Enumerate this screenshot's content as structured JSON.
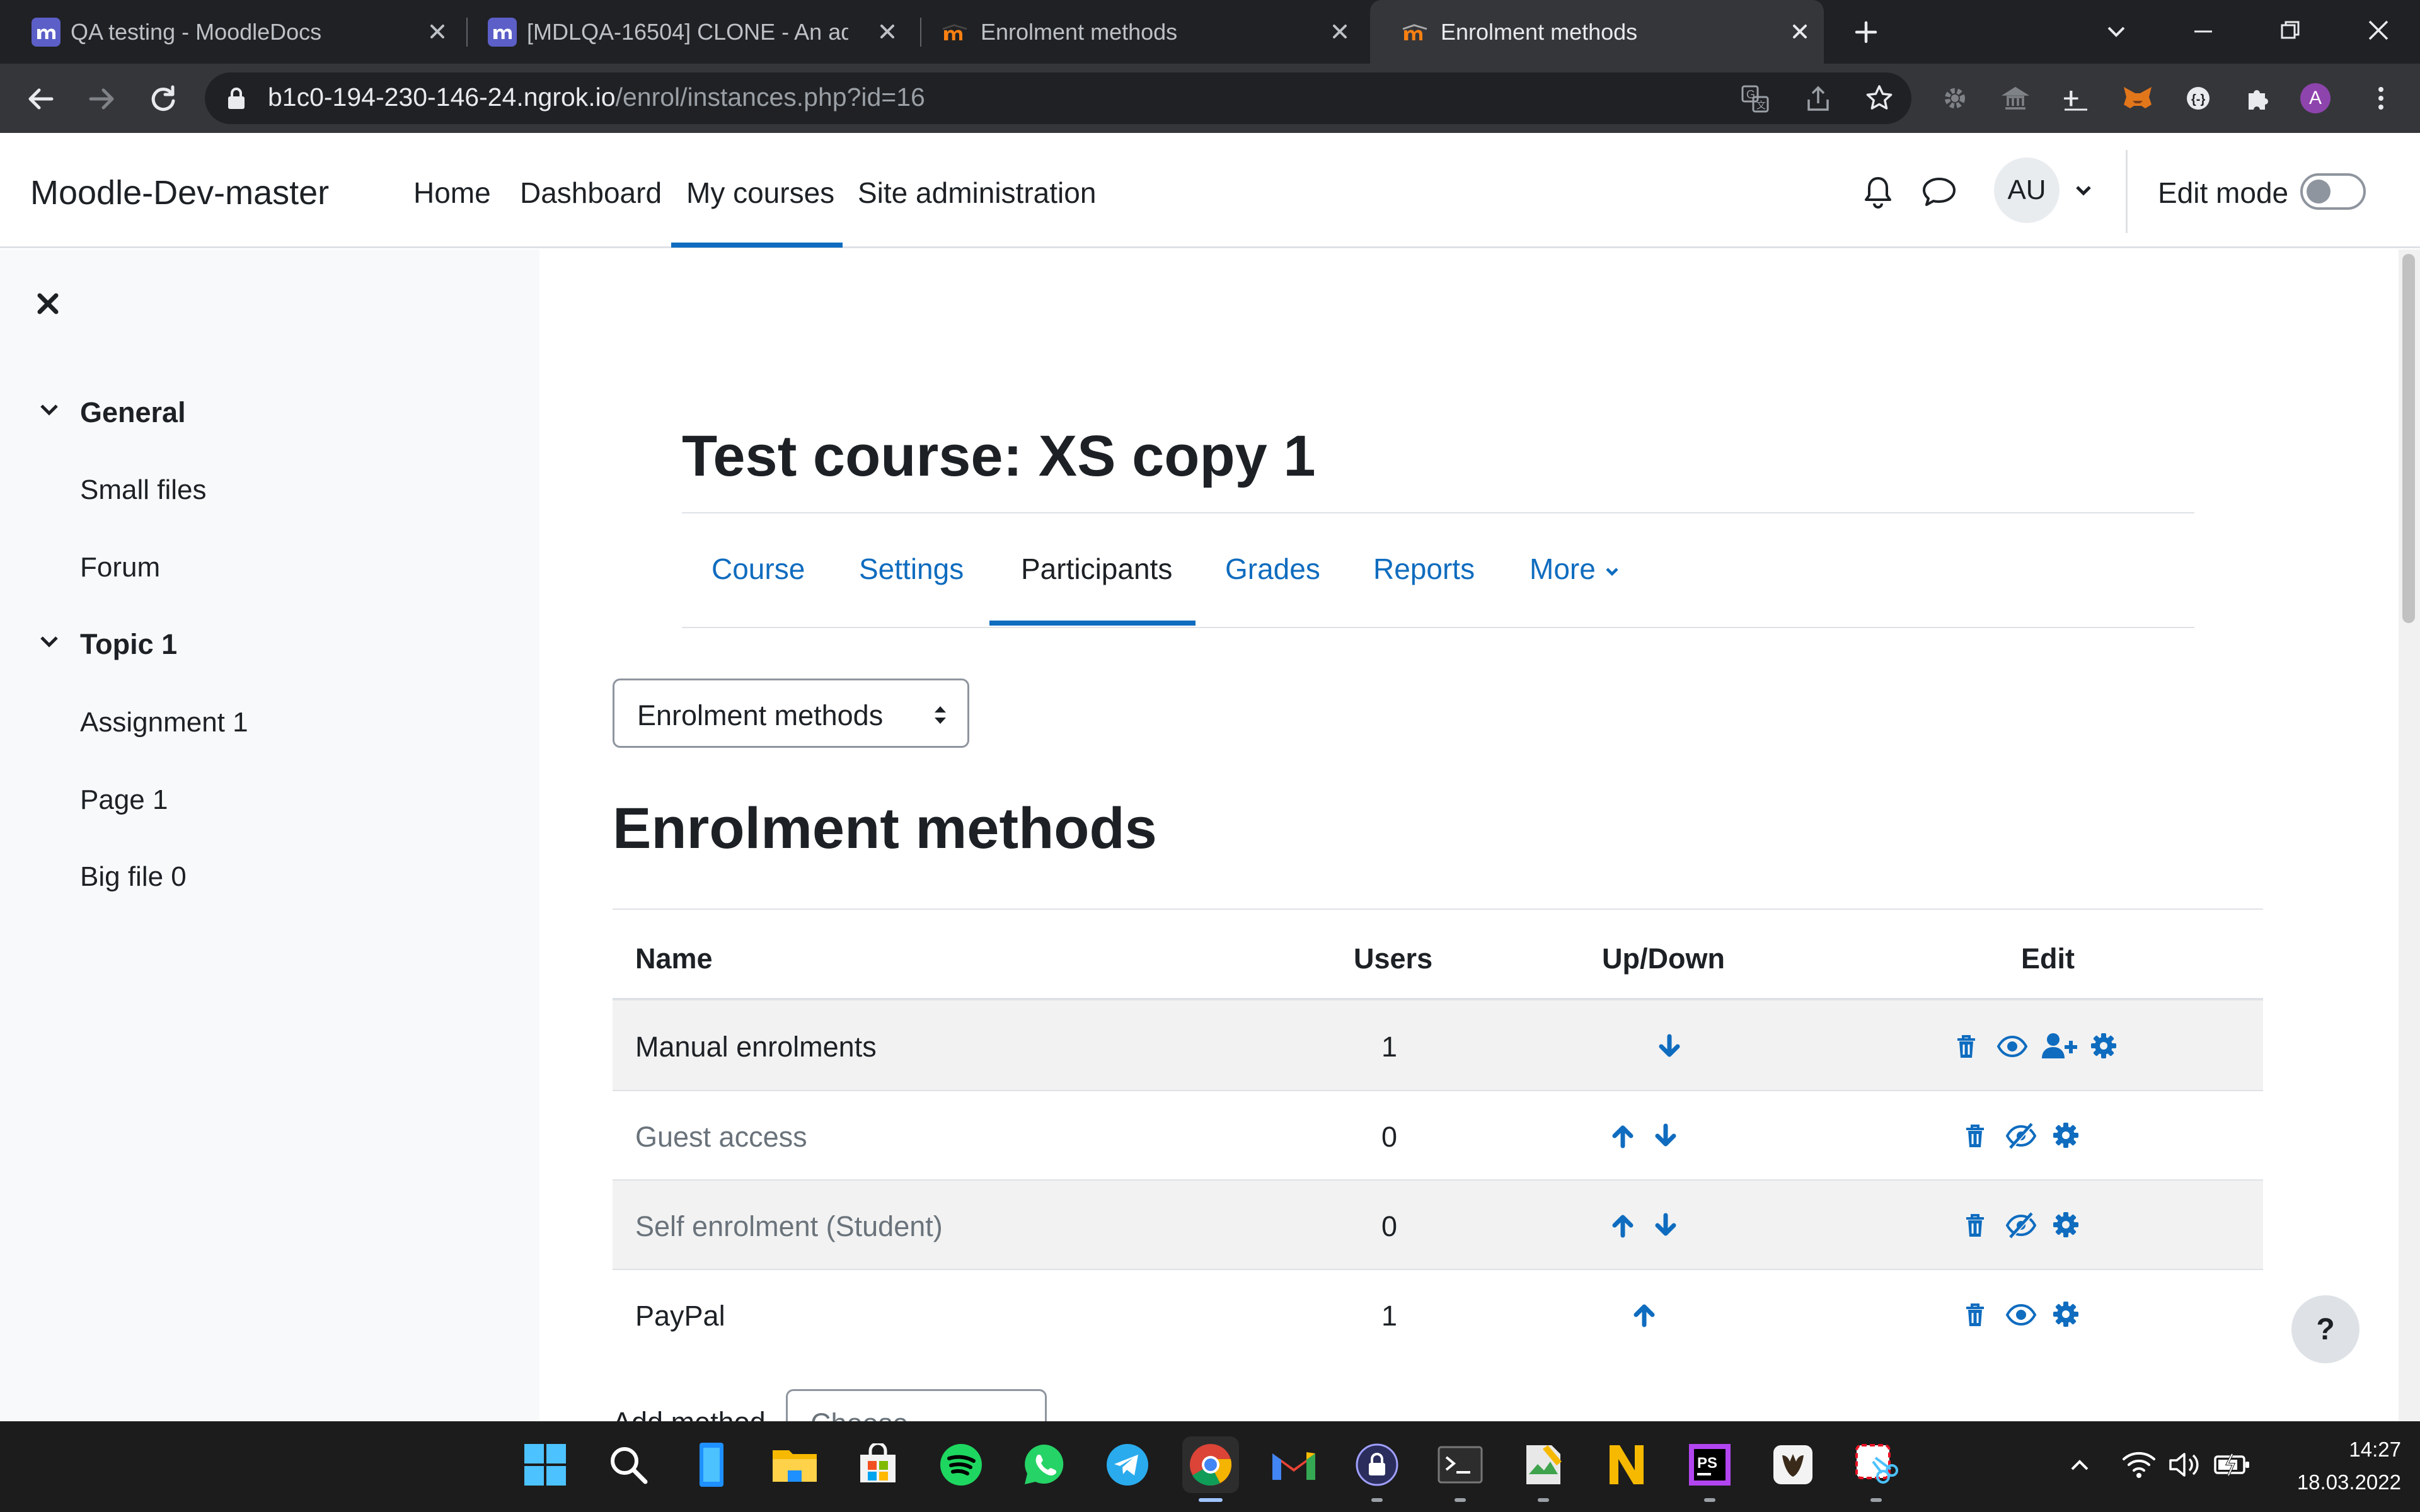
{
  "browser": {
    "tabs": [
      {
        "title": "QA testing - MoodleDocs",
        "active": false
      },
      {
        "title": "[MDLQA-16504] CLONE - An adm",
        "active": false
      },
      {
        "title": "Enrolment methods",
        "active": false
      },
      {
        "title": "Enrolment methods",
        "active": true
      }
    ],
    "url_host": "b1c0-194-230-146-24.ngrok.io",
    "url_path": "/enrol/instances.php?id=16",
    "profile_initial": "A"
  },
  "navbar": {
    "site_name": "Moodle-Dev-master",
    "links": [
      "Home",
      "Dashboard",
      "My courses",
      "Site administration"
    ],
    "active_link": "My courses",
    "user_initials": "AU",
    "edit_mode_label": "Edit mode",
    "edit_mode_on": false
  },
  "drawer": {
    "sections": [
      {
        "title": "General",
        "items": [
          "Small files",
          "Forum"
        ]
      },
      {
        "title": "Topic 1",
        "items": [
          "Assignment 1",
          "Page 1",
          "Big file 0"
        ]
      }
    ]
  },
  "course": {
    "title": "Test course: XS copy 1",
    "tabs": [
      "Course",
      "Settings",
      "Participants",
      "Grades",
      "Reports",
      "More"
    ],
    "active_tab": "Participants"
  },
  "page": {
    "selector_value": "Enrolment methods",
    "heading": "Enrolment methods",
    "help_label": "?",
    "add_method_label": "Add method",
    "add_method_placeholder": "Choose..."
  },
  "table": {
    "headers": {
      "name": "Name",
      "users": "Users",
      "updown": "Up/Down",
      "edit": "Edit"
    },
    "rows": [
      {
        "name": "Manual enrolments",
        "users": "1",
        "enabled": true,
        "up": false,
        "down": true,
        "enrol_users": true
      },
      {
        "name": "Guest access",
        "users": "0",
        "enabled": false,
        "up": true,
        "down": true,
        "enrol_users": false
      },
      {
        "name": "Self enrolment (Student)",
        "users": "0",
        "enabled": false,
        "up": true,
        "down": true,
        "enrol_users": false
      },
      {
        "name": "PayPal",
        "users": "1",
        "enabled": true,
        "up": true,
        "down": false,
        "enrol_users": false
      }
    ]
  },
  "taskbar": {
    "apps": [
      "start-icon",
      "search-icon",
      "widgets-icon",
      "file-explorer-icon",
      "store-icon",
      "spotify-icon",
      "whatsapp-icon",
      "telegram-icon",
      "chrome-icon",
      "gmail-icon",
      "vpn-icon",
      "terminal-icon",
      "editor-icon",
      "notion-icon",
      "phpstorm-icon",
      "app-icon",
      "snipping-tool-icon"
    ],
    "time": "14:27",
    "date": "18.03.2022"
  },
  "colors": {
    "link": "#0f6cbf",
    "text": "#1d2125",
    "muted": "#6a737b",
    "chrome_dark": "#202124"
  }
}
